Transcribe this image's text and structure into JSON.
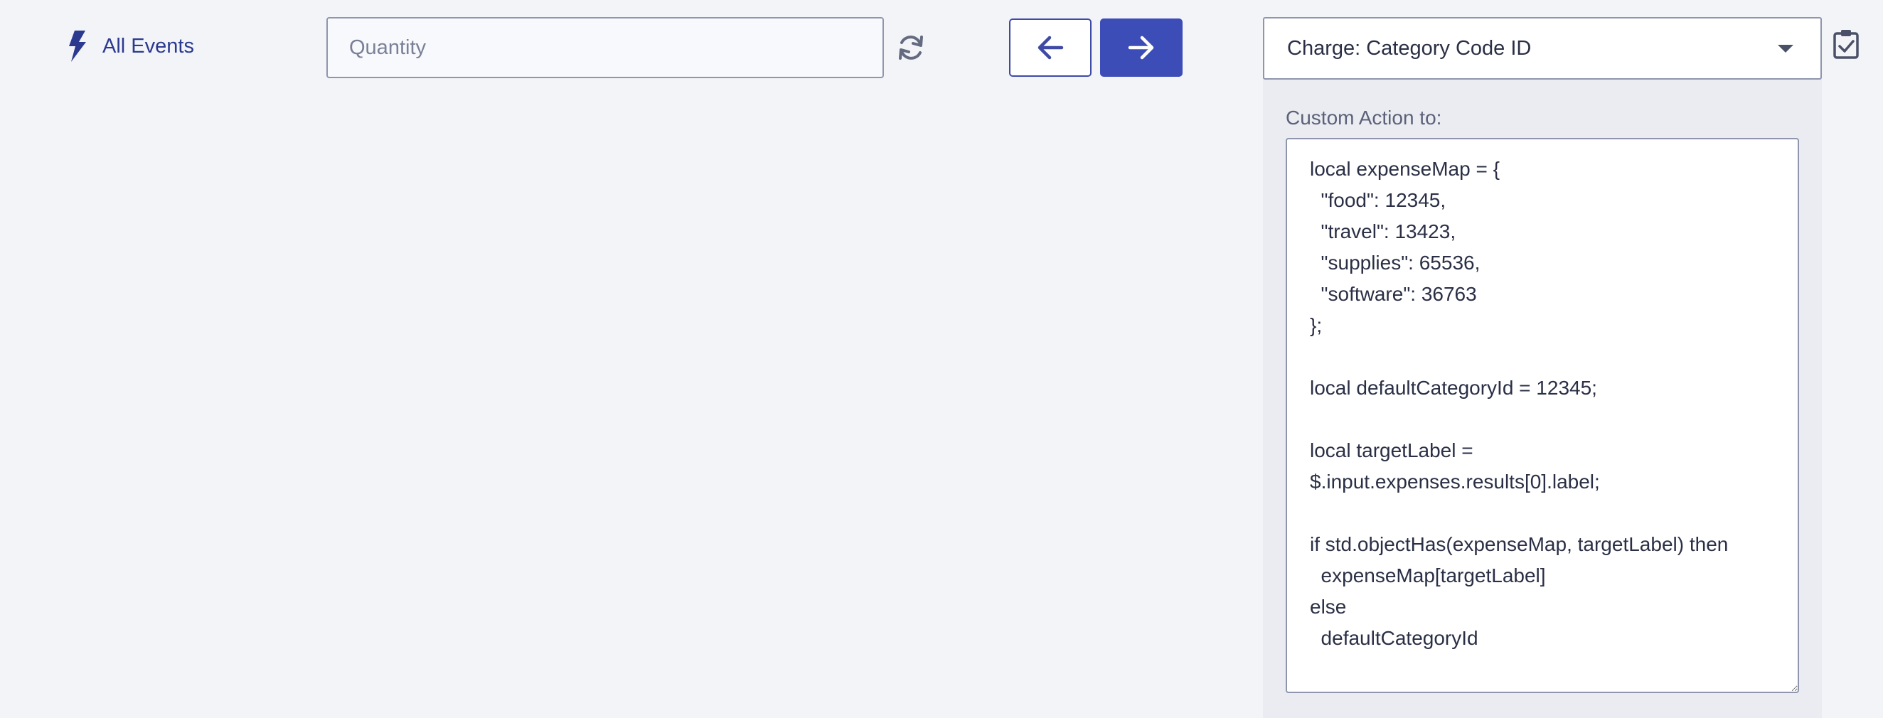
{
  "toolbar": {
    "all_events_label": "All Events",
    "search_placeholder": "Quantity",
    "search_value": "",
    "prev_icon": "arrow-left-icon",
    "next_icon": "arrow-right-icon",
    "refresh_icon": "refresh-icon"
  },
  "mapping": {
    "selected_field": "Charge: Category Code ID",
    "custom_action_label": "Custom Action to:",
    "custom_action_code": "local expenseMap = {\n  \"food\": 12345,\n  \"travel\": 13423,\n  \"supplies\": 65536,\n  \"software\": 36763\n};\n\nlocal defaultCategoryId = 12345;\n\nlocal targetLabel =\n$.input.expenses.results[0].label;\n\nif std.objectHas(expenseMap, targetLabel) then\n  expenseMap[targetLabel]\nelse\n  defaultCategoryId",
    "confirm_icon": "clipboard-check-icon"
  },
  "colors": {
    "accent": "#3d4db7",
    "link": "#2b3a8f",
    "background": "#f3f4f8"
  }
}
